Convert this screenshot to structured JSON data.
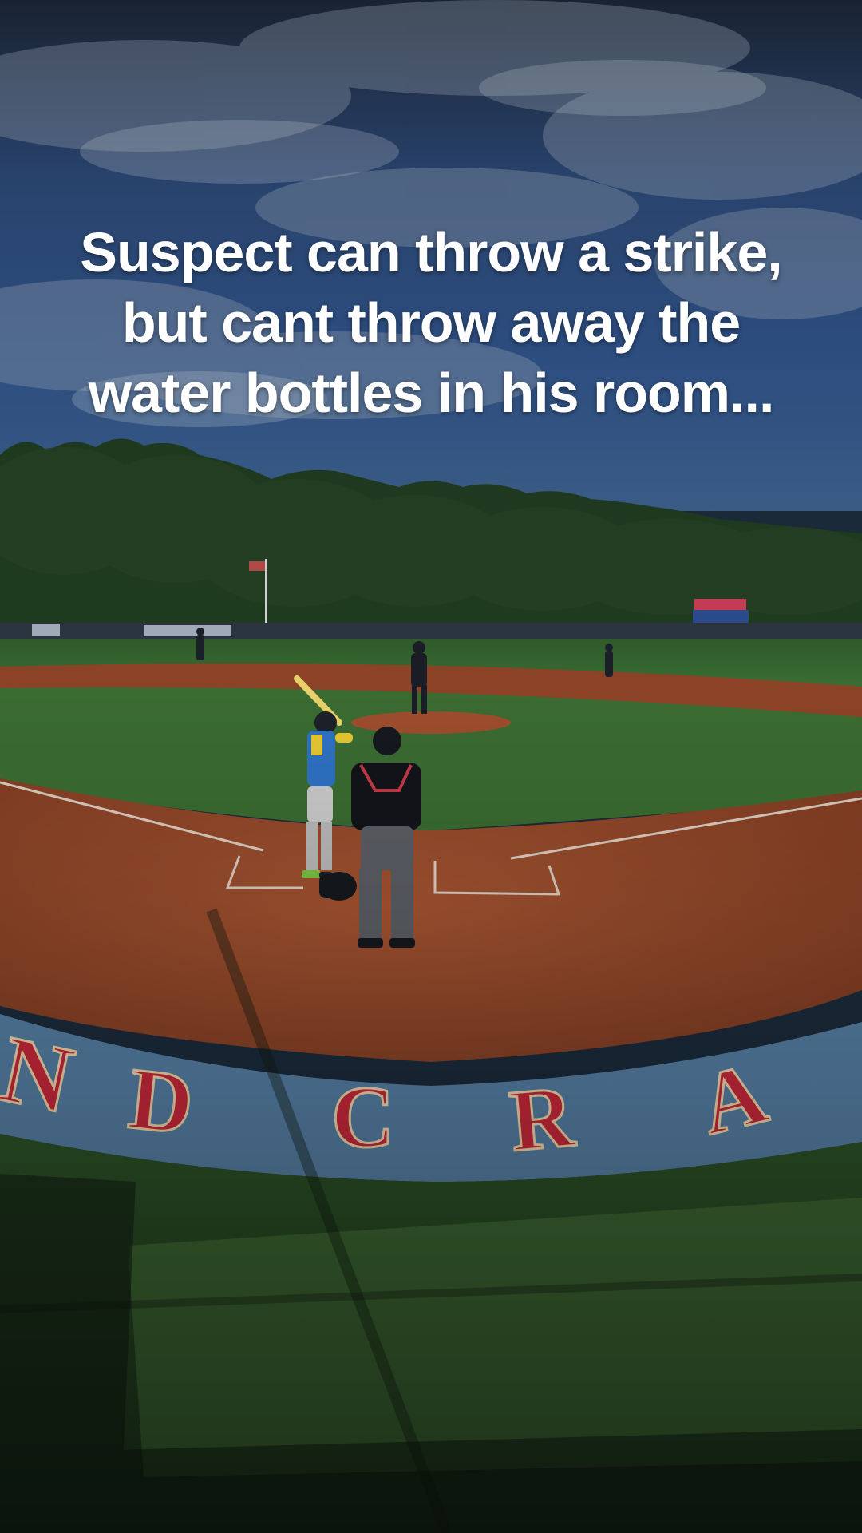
{
  "caption": {
    "line1": "Suspect can throw a strike,",
    "line2": "but cant throw away the",
    "line3": "water bottles in his room..."
  },
  "field_logo_letters": "NDCRA",
  "colors": {
    "sky_top": "#1d2a3d",
    "sky_mid": "#2c4d7e",
    "trees": "#1f3520",
    "grass": "#2e5a2c",
    "dirt": "#9a4b2b",
    "logo_blue": "#5a86ad",
    "logo_red": "#c8283a",
    "caption_text": "#ffffff"
  }
}
